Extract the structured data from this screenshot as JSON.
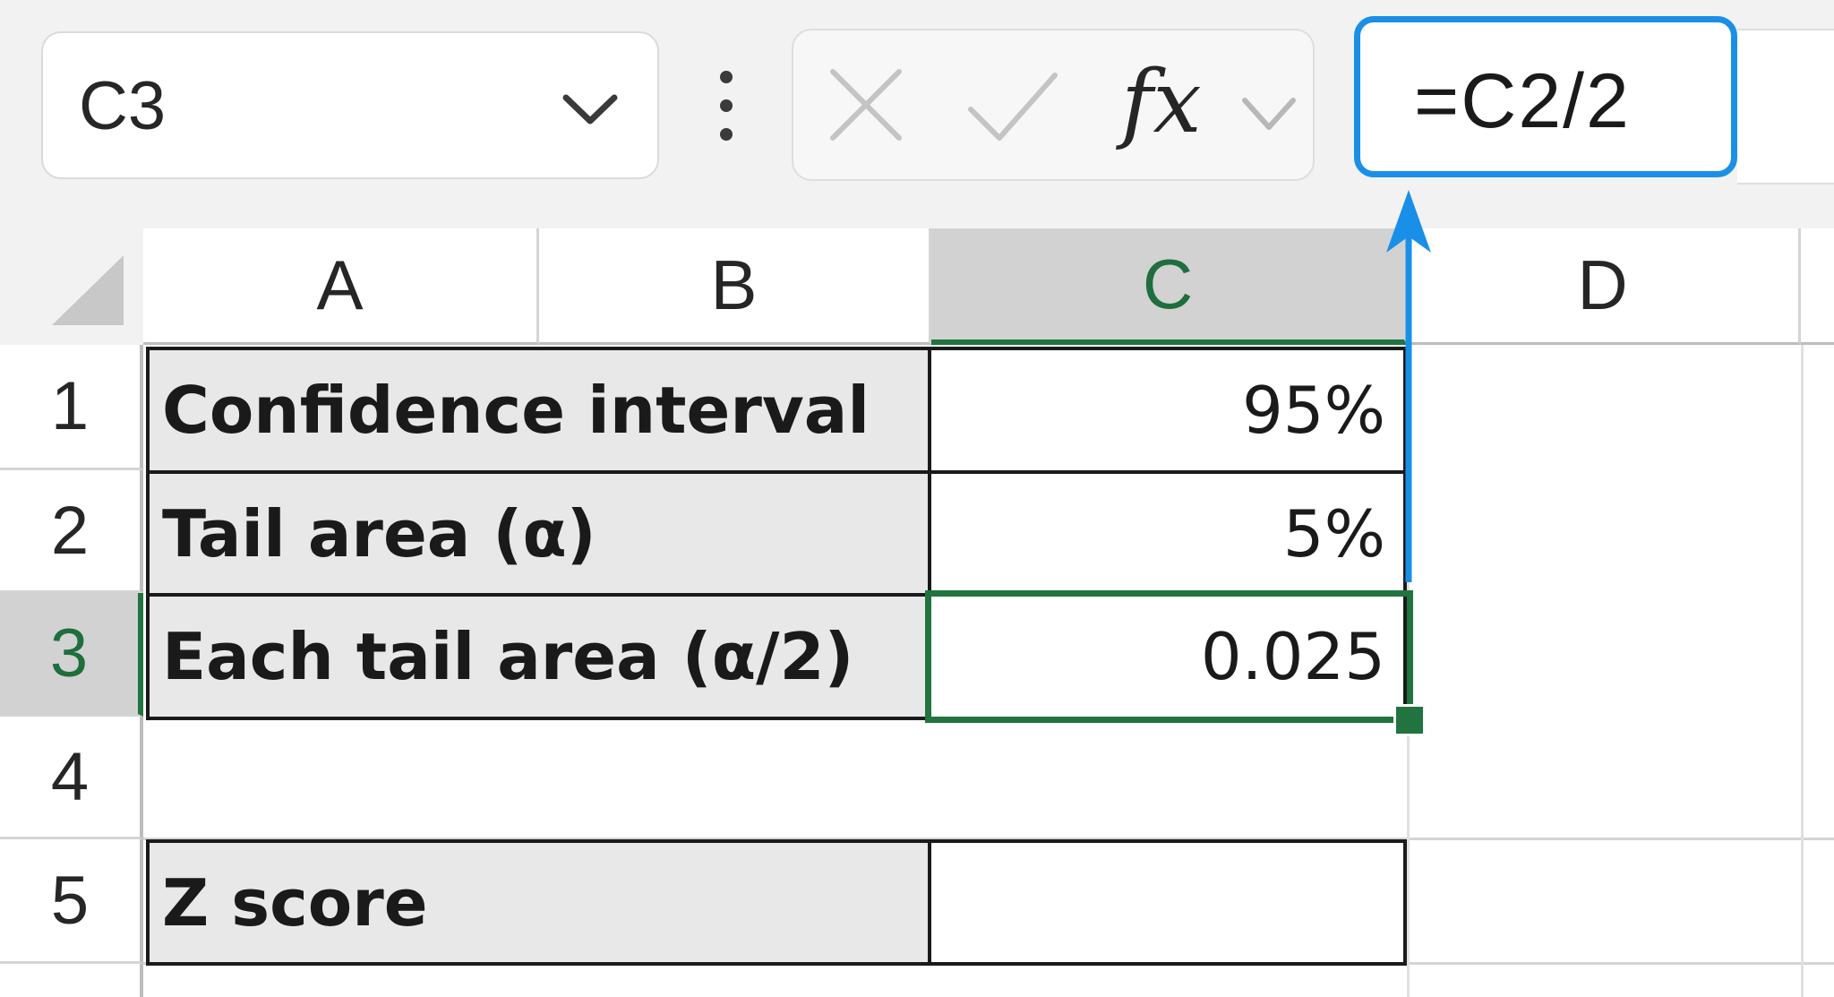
{
  "name_box": {
    "value": "C3"
  },
  "formula_bar": {
    "cancel_icon": "x-icon",
    "enter_icon": "check-icon",
    "fx_label": "fx",
    "formula": "=C2/2"
  },
  "columns": [
    {
      "label": "A"
    },
    {
      "label": "B"
    },
    {
      "label": "C",
      "selected": true
    },
    {
      "label": "D"
    }
  ],
  "rows": [
    "1",
    "2",
    "3",
    "4",
    "5"
  ],
  "cells": {
    "a1": "Confidence interval",
    "c1": "95%",
    "a2": "Tail area (α)",
    "c2": "5%",
    "a3": "Each tail area (α/2)",
    "c3": "0.025",
    "a5": "Z score",
    "c5": ""
  },
  "colors": {
    "selection_green": "#21743f",
    "annotation_blue": "#1a8fe8",
    "label_fill": "#e8e8e8"
  }
}
